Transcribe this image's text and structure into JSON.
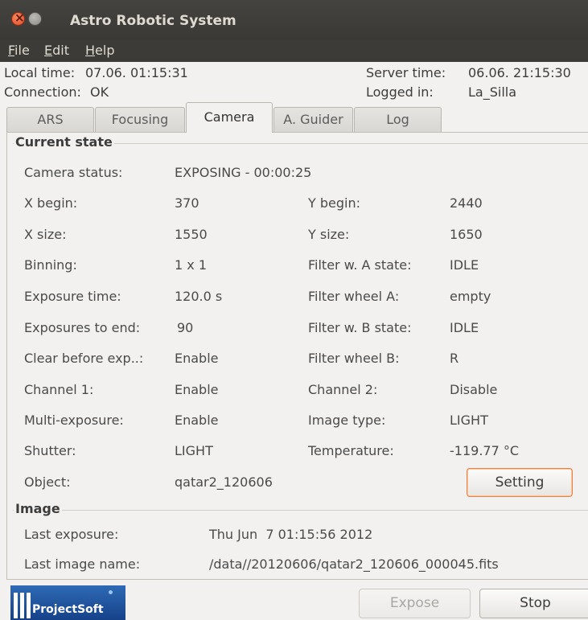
{
  "window": {
    "title": "Astro Robotic System"
  },
  "menu": {
    "file": "File",
    "edit": "Edit",
    "help": "Help"
  },
  "status": {
    "local_time_label": "Local time:",
    "local_time": "07.06. 01:15:31",
    "connection_label": "Connection:",
    "connection": "OK",
    "server_time_label": "Server time:",
    "server_time": "06.06. 21:15:30",
    "logged_in_label": "Logged in:",
    "logged_in": "La_Silla"
  },
  "tabs": [
    "ARS",
    "Focusing",
    "Camera",
    "A. Guider",
    "Log"
  ],
  "current_state": {
    "title": "Current state",
    "camera_status_label": "Camera status:",
    "camera_status": "EXPOSING - 00:00:25",
    "rows": [
      {
        "l1": "X begin:",
        "v1": "370",
        "l2": "Y begin:",
        "v2": "2440"
      },
      {
        "l1": "X size:",
        "v1": "1550",
        "l2": "Y size:",
        "v2": "1650"
      },
      {
        "l1": "Binning:",
        "v1": "1 x 1",
        "l2": "Filter w. A state:",
        "v2": "IDLE"
      },
      {
        "l1": "Exposure time:",
        "v1": "120.0 s",
        "l2": "Filter wheel A:",
        "v2": "empty"
      },
      {
        "l1": "Exposures to end:",
        "v1": "90",
        "l2": "Filter w. B state:",
        "v2": "IDLE"
      },
      {
        "l1": "Clear before exp..:",
        "v1": "Enable",
        "l2": "Filter wheel  B:",
        "v2": "R"
      },
      {
        "l1": "Channel 1:",
        "v1": "Enable",
        "l2": "Channel 2:",
        "v2": "Disable"
      },
      {
        "l1": "Multi-exposure:",
        "v1": "Enable",
        "l2": "Image type:",
        "v2": "LIGHT"
      },
      {
        "l1": "Shutter:",
        "v1": "LIGHT",
        "l2": "Temperature:",
        "v2": "-119.77 °C"
      }
    ],
    "object_label": "Object:",
    "object": "qatar2_120606",
    "setting_button": "Setting"
  },
  "image": {
    "title": "Image",
    "last_exposure_label": "Last exposure:",
    "last_exposure": "Thu Jun  7 01:15:56 2012",
    "last_image_name_label": "Last image name:",
    "last_image_name": "/data//20120606/qatar2_120606_000045.fits"
  },
  "buttons": {
    "expose": "Expose",
    "stop": "Stop"
  },
  "logo": {
    "text": "ProjectSoft"
  }
}
